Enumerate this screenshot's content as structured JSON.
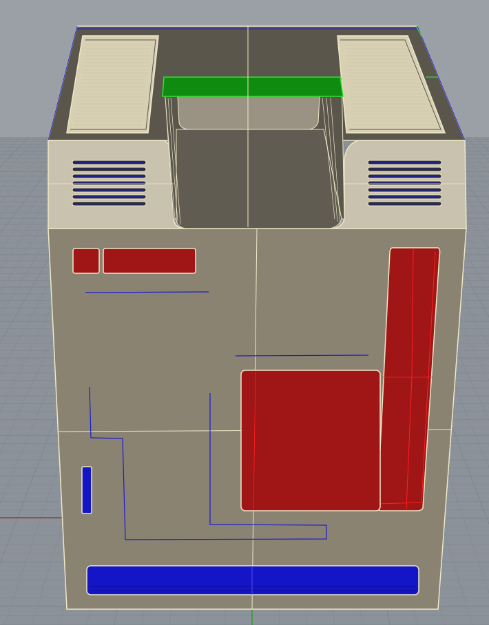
{
  "viewport": {
    "background_color": "#9aa0a6",
    "grid_color": "#8c9299",
    "grid_line_color": "#7f858c",
    "x_axis_color": "#b03030",
    "y_axis_color": "#2e9a2e"
  },
  "model": {
    "body_color": "#8a8372",
    "top_color": "#5a564c",
    "upper_panel_color": "#c9c2ae",
    "vent_panel_color": "#d8d0b3",
    "edge_color": "#efe8c8",
    "red_color": "#a01515",
    "red_edge_color": "#ff2020",
    "blue_color": "#1515c8",
    "blue_line_color": "#1a1ad0",
    "green_color": "#0f8c0f",
    "green_edge_color": "#2ee02e"
  }
}
